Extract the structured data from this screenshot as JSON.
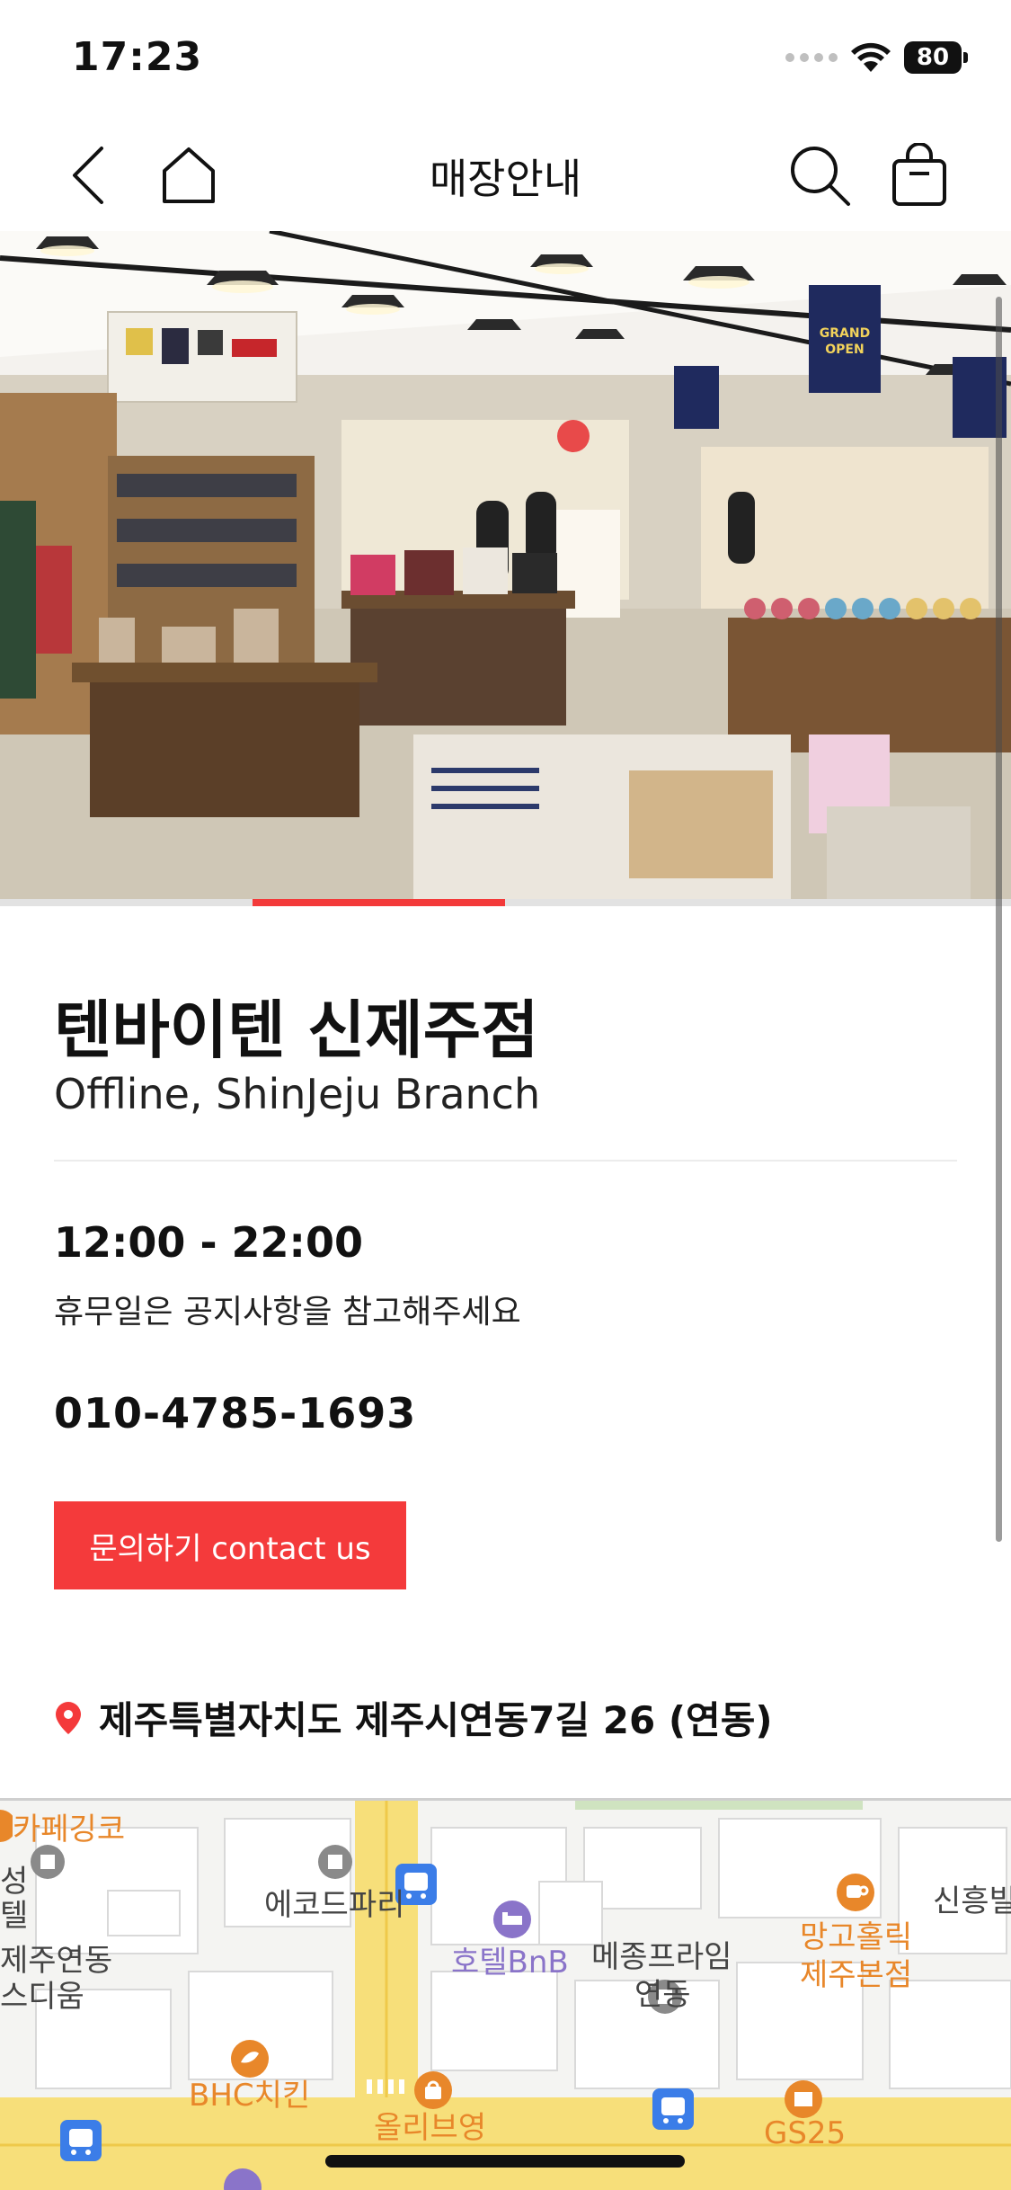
{
  "status_bar": {
    "time": "17:23",
    "battery": "80"
  },
  "nav": {
    "title": "매장안내"
  },
  "store": {
    "name": "텐바이텐 신제주점",
    "subtitle": "Offline, ShinJeju Branch",
    "hours": "12:00 - 22:00",
    "hours_note": "휴무일은 공지사항을 참고해주세요",
    "phone": "010-4785-1693",
    "contact_label": "문의하기 contact us",
    "address": "제주특별자치도 제주시연동7길 26 (연동)"
  },
  "hero": {
    "slide_progress": 0.25
  },
  "map": {
    "labels": {
      "cafe": "카페깅코",
      "ecode": "에코드파리",
      "hotel": "호텔BnB",
      "mejong": "메종프라임",
      "yeondong": "연동",
      "mango_1": "망고홀릭",
      "mango_2": "제주본점",
      "sinheung": "신흥빌",
      "jeju_yeondong": "제주연동",
      "stadium": "스디움",
      "seong": "성",
      "hotel_left": "텔",
      "bhc": "BHC치킨",
      "olive": "올리브영",
      "gs25": "GS25"
    },
    "colors": {
      "poi_orange": "#e8872a",
      "poi_purple": "#8a74c9",
      "bus_blue": "#3b7de8",
      "road_yellow": "#f7df7a"
    }
  },
  "colors": {
    "accent": "#f43a3b"
  }
}
